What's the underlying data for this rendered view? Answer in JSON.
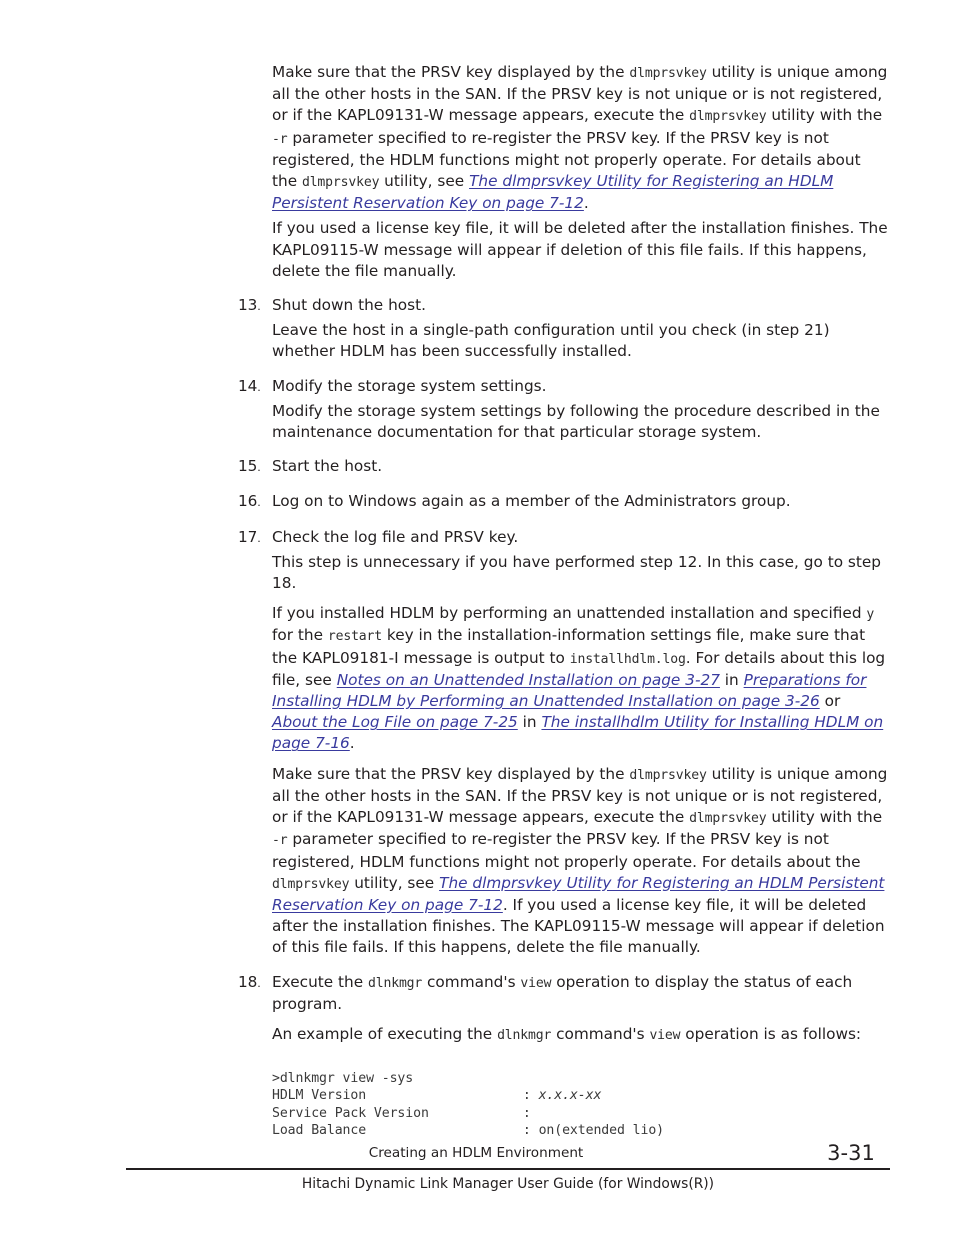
{
  "document": {
    "page_number": "3-31",
    "chapter_title": "Creating an HDLM Environment",
    "book_title": "Hitachi Dynamic Link Manager User Guide (for Windows(R))"
  },
  "colors": {
    "text": "#231f20",
    "link": "#393a9e",
    "code": "#2f2f2f"
  },
  "body": {
    "prsv_para_1": {
      "s1": "Make sure that the PRSV key displayed by the ",
      "c1": "dlmprsvkey",
      "s2": " utility is unique among all the other hosts in the SAN. If the PRSV key is not unique or is not registered, or if the KAPL09131-W message appears, execute the ",
      "c2": "dlmprsvkey",
      "s3": " utility with the ",
      "c3": "-r",
      "s4": " parameter specified to re-register the PRSV key. If the PRSV key is not registered, the HDLM functions might not properly operate. For details about the ",
      "c4": "dlmprsvkey",
      "s5": " utility, see ",
      "link1": "The dlmprsvkey Utility for Registering an HDLM Persistent Reservation Key on page 7-12",
      "s6": "."
    },
    "license_para_1": "If you used a license key file, it will be deleted after the installation finishes. The KAPL09115-W message will appear if deletion of this file fails. If this happens, delete the file manually.",
    "step13": {
      "num": "13",
      "title": "Shut down the host.",
      "body": "Leave the host in a single-path configuration until you check (in step 21) whether HDLM has been successfully installed."
    },
    "step14": {
      "num": "14",
      "title": "Modify the storage system settings.",
      "body": "Modify the storage system settings by following the procedure described in the maintenance documentation for that particular storage system."
    },
    "step15": {
      "num": "15",
      "title": "Start the host."
    },
    "step16": {
      "num": "16",
      "title": "Log on to Windows again as a member of the Administrators group."
    },
    "step17": {
      "num": "17",
      "title": "Check the log file and PRSV key.",
      "body1": "This step is unnecessary if you have performed step 12. In this case, go to step 18.",
      "unattended": {
        "s1": "If you installed HDLM by performing an unattended installation and specified ",
        "c1": "y",
        "s2": " for the ",
        "c2": "restart",
        "s3": " key in the installation-information settings file, make sure that the KAPL09181-I message is output to ",
        "c3": "installhdlm.log",
        "s4": ". For details about this log file, see ",
        "link1": "Notes on an Unattended Installation on page 3-27",
        "s5": " in ",
        "link2": "Preparations for Installing HDLM by Performing an Unattended Installation on page 3-26",
        "s6": " or ",
        "link3": "About the Log File on page 7-25",
        "s7": " in ",
        "link4": "The installhdlm Utility for Installing HDLM on page 7-16",
        "s8": "."
      },
      "prsv": {
        "s1": "Make sure that the PRSV key displayed by the ",
        "c1": "dlmprsvkey",
        "s2": " utility is unique among all the other hosts in the SAN. If the PRSV key is not unique or is not registered, or if the KAPL09131-W message appears, execute the ",
        "c2": "dlmprsvkey",
        "s3": " utility with the ",
        "c3": "-r",
        "s4": " parameter specified to re-register the PRSV key. If the PRSV key is not registered, HDLM functions might not properly operate. For details about the ",
        "c4": "dlmprsvkey",
        "s5": " utility, see ",
        "link1": "The dlmprsvkey Utility for Registering an HDLM Persistent Reservation Key on page 7-12",
        "s6": ". If you used a license key file, it will be deleted after the installation finishes. The KAPL09115-W message will appear if deletion of this file fails. If this happens, delete the file manually."
      }
    },
    "step18": {
      "num": "18",
      "title": {
        "s1": "Execute the ",
        "c1": "dlnkmgr",
        "s2": " command's ",
        "c2": "view",
        "s3": " operation to display the status of each program."
      },
      "body": {
        "s1": "An example of executing the ",
        "c1": "dlnkmgr",
        "s2": " command's ",
        "c2": "view",
        "s3": " operation is as follows:"
      },
      "code": {
        "line1": ">dlnkmgr view -sys",
        "line2_label": "HDLM Version",
        "line2_sep": ": ",
        "line2_value": "x.x.x-xx",
        "line3_label": "Service Pack Version",
        "line3_sep": ":",
        "line4_label": "Load Balance",
        "line4_sep": ": ",
        "line4_value": "on(extended lio)"
      }
    }
  }
}
